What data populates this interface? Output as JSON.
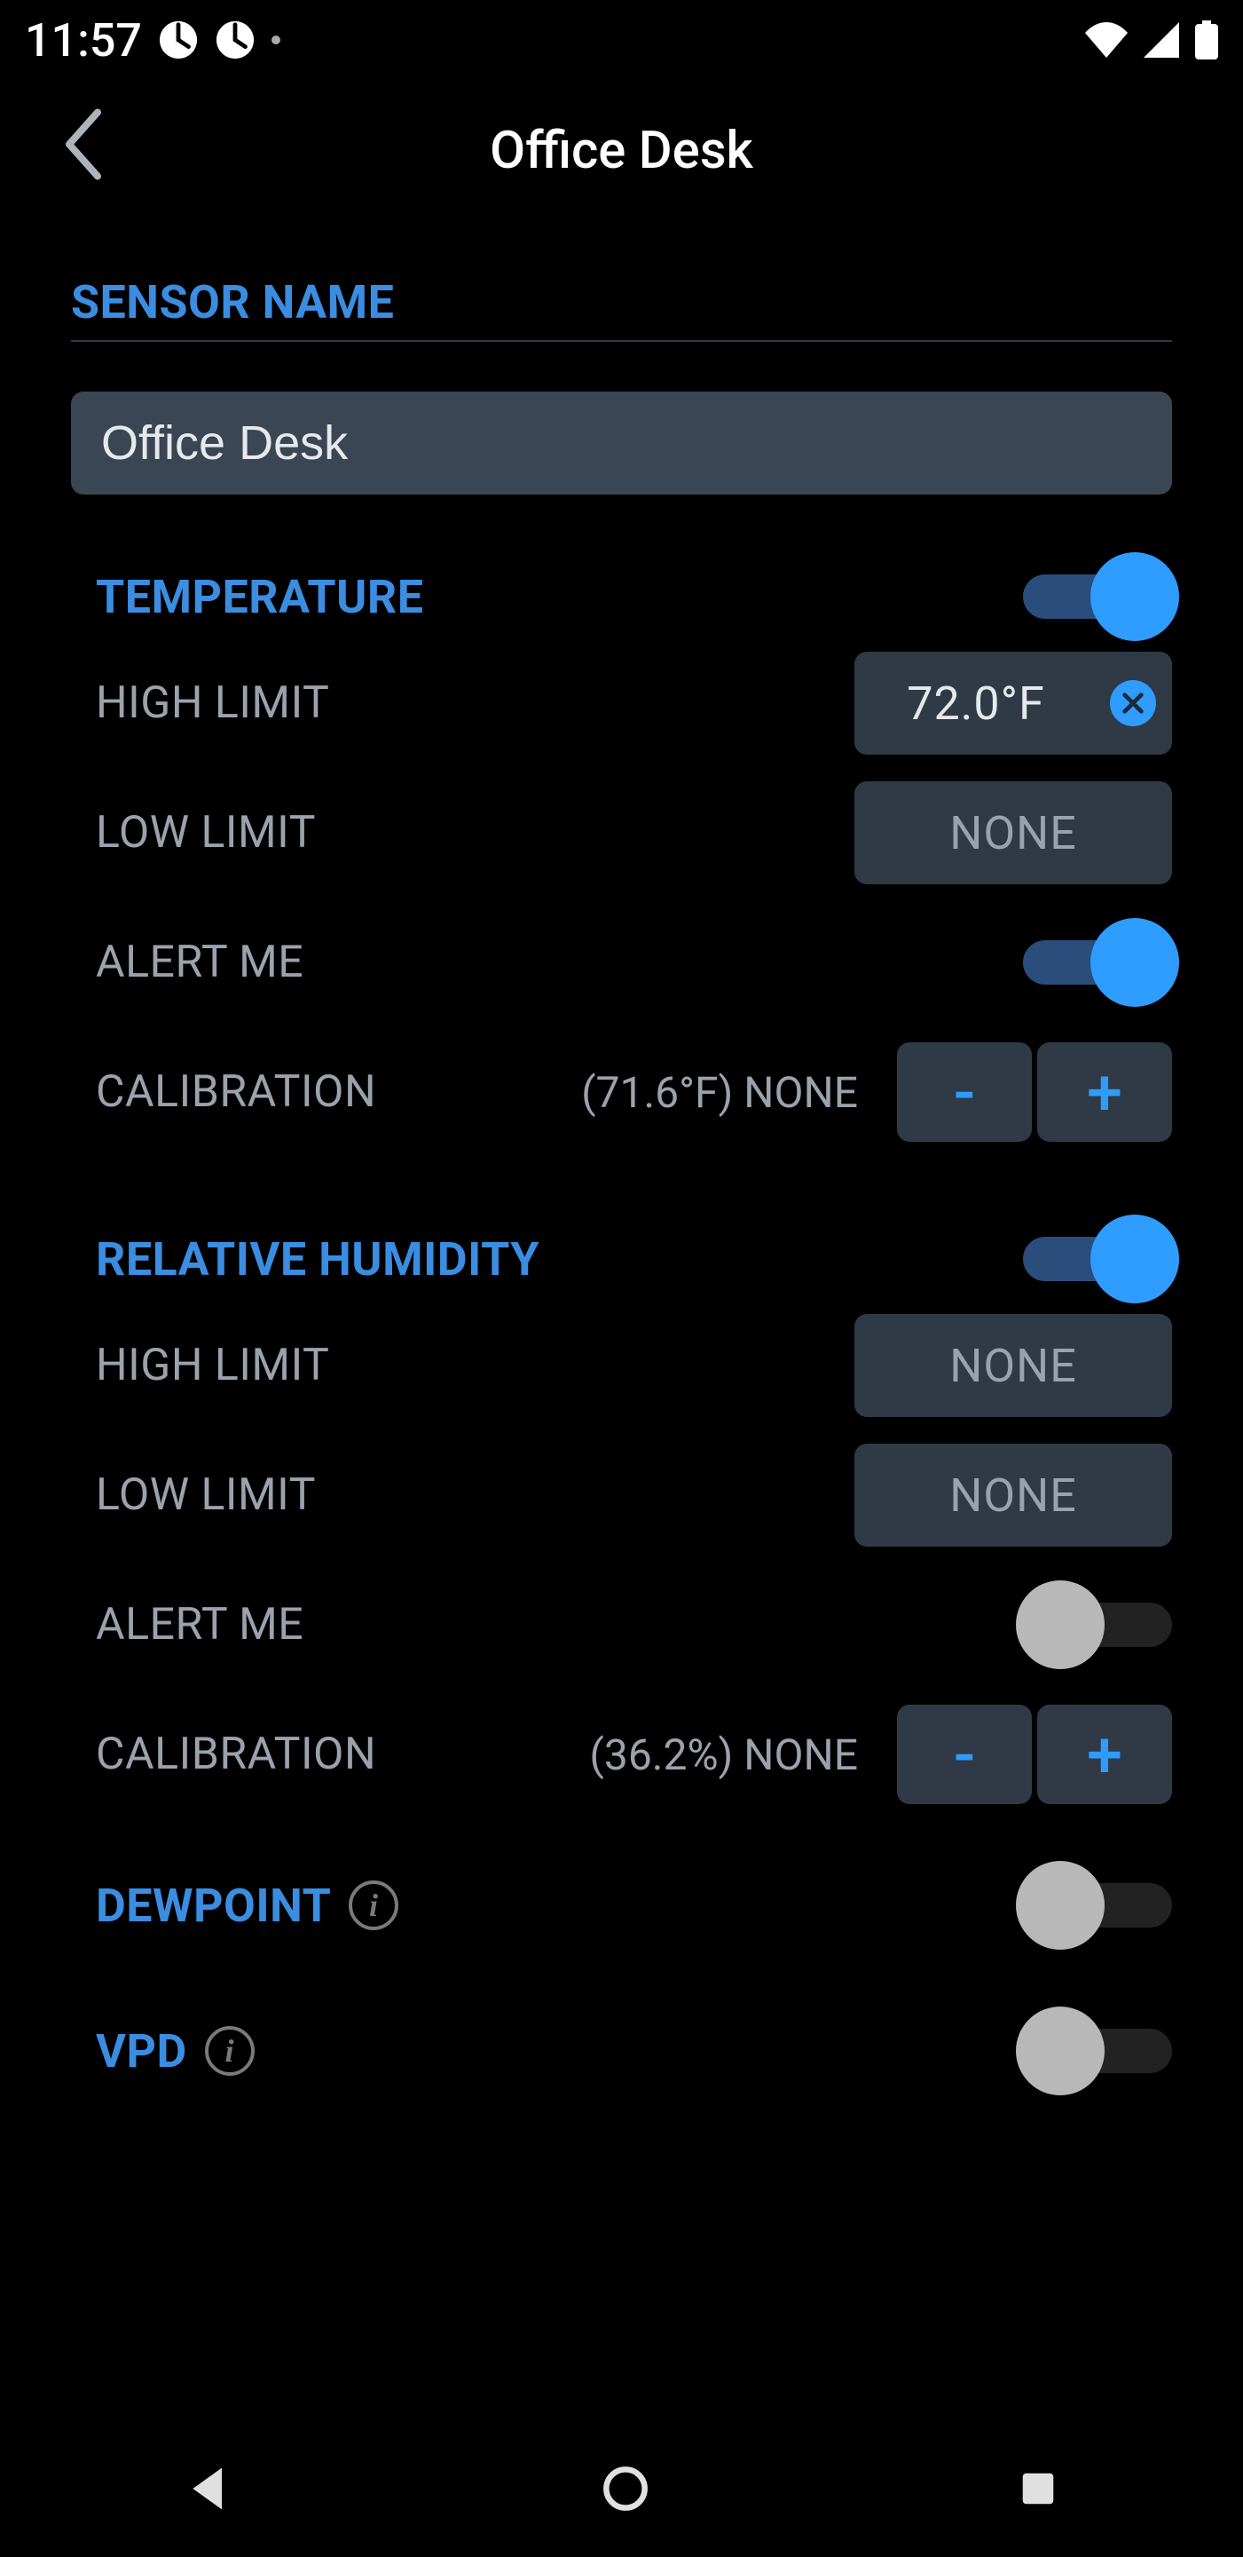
{
  "statusbar": {
    "time": "11:57"
  },
  "header": {
    "title": "Office Desk"
  },
  "sensorName": {
    "label": "SENSOR NAME",
    "value": "Office Desk"
  },
  "temperature": {
    "label": "TEMPERATURE",
    "enabled": true,
    "highLimit": {
      "label": "HIGH LIMIT",
      "value": "72.0°F"
    },
    "lowLimit": {
      "label": "LOW LIMIT",
      "value": "NONE"
    },
    "alertMe": {
      "label": "ALERT ME",
      "enabled": true
    },
    "calibration": {
      "label": "CALIBRATION",
      "reading": "(71.6°F) NONE"
    }
  },
  "humidity": {
    "label": "RELATIVE HUMIDITY",
    "enabled": true,
    "highLimit": {
      "label": "HIGH LIMIT",
      "value": "NONE"
    },
    "lowLimit": {
      "label": "LOW LIMIT",
      "value": "NONE"
    },
    "alertMe": {
      "label": "ALERT ME",
      "enabled": false
    },
    "calibration": {
      "label": "CALIBRATION",
      "reading": "(36.2%) NONE"
    }
  },
  "dewpoint": {
    "label": "DEWPOINT",
    "enabled": false
  },
  "vpd": {
    "label": "VPD",
    "enabled": false
  },
  "glyphs": {
    "minus": "-",
    "plus": "+"
  }
}
